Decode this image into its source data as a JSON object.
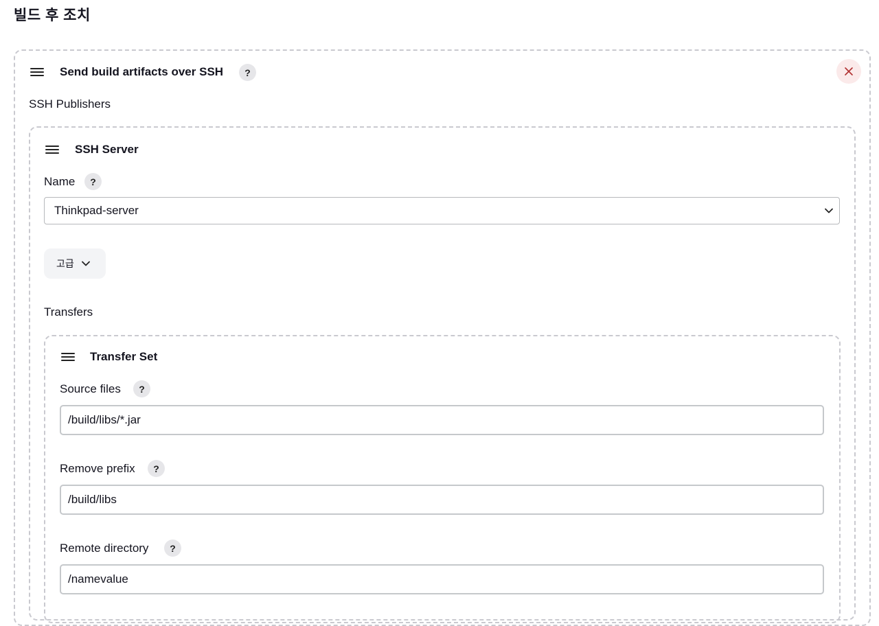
{
  "section": {
    "title": "빌드 후 조치"
  },
  "step": {
    "title": "Send build artifacts over SSH",
    "help": "?",
    "close_icon": "close-icon"
  },
  "publishers": {
    "label": "SSH Publishers"
  },
  "server": {
    "title": "SSH Server",
    "name_label": "Name",
    "name_help": "?",
    "name_value": "Thinkpad-server",
    "advanced_label": "고급"
  },
  "transfers": {
    "label": "Transfers",
    "set_title": "Transfer Set",
    "source_label": "Source files",
    "source_help": "?",
    "source_value": "/build/libs/*.jar",
    "prefix_label": "Remove prefix",
    "prefix_help": "?",
    "prefix_value": "/build/libs",
    "remote_label": "Remote directory",
    "remote_help": "?",
    "remote_value": "/namevalue"
  },
  "colors": {
    "close_bg": "#fbeaea",
    "close_x": "#b03030",
    "dashed_border": "#c9c9cf",
    "help_bg": "#e6e6e9"
  }
}
